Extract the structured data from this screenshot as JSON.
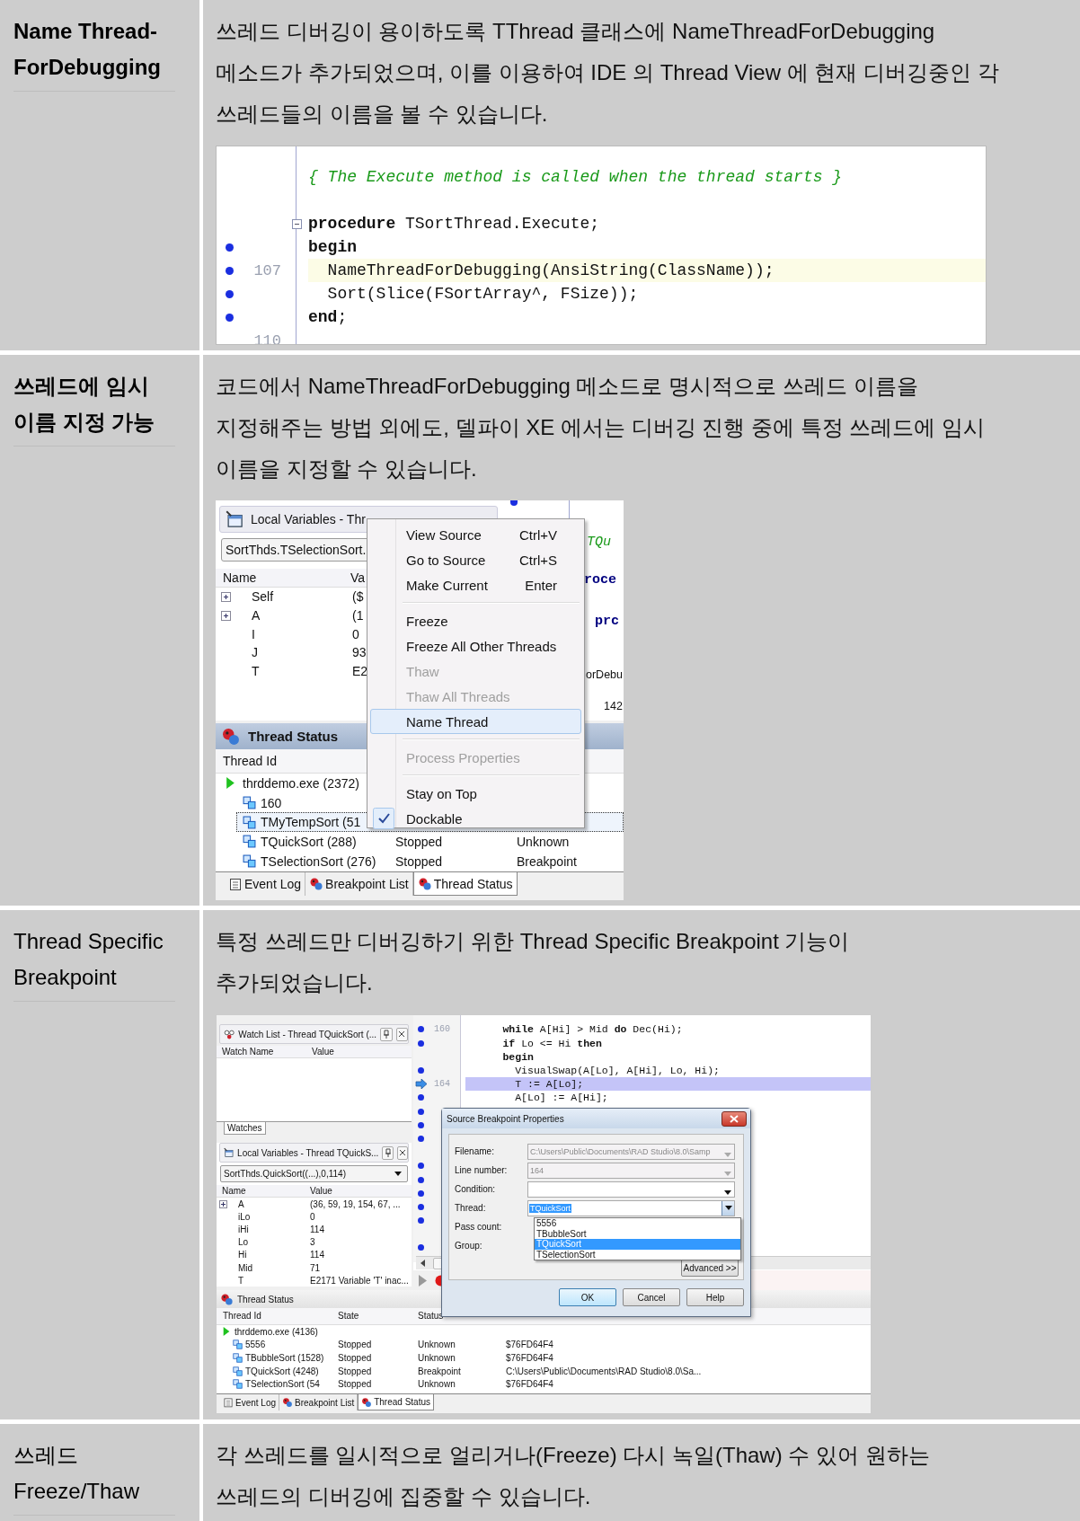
{
  "rows": [
    {
      "label": "Name Thread-ForDebugging",
      "label_bold": true,
      "text": "쓰레드 디버깅이 용이하도록 TThread 클래스에 NameThreadForDebugging 메소드가 추가되었으며, 이를 이용하여 IDE 의 Thread View 에 현재 디버깅중인 각 쓰레드들의 이름을 볼 수 있습니다.",
      "screenshot": {
        "kind": "code_editor",
        "lines": [
          {
            "kind": "blank",
            "breakpoint": false,
            "current": false,
            "fold": false
          },
          {
            "kind": "comment",
            "code": "{ The Execute method is called when the thread starts }",
            "breakpoint": false,
            "current": false,
            "fold": false
          },
          {
            "kind": "blank",
            "breakpoint": false,
            "current": false,
            "fold": false
          },
          {
            "kind": "code",
            "code": "**procedure** TSortThread.Execute;",
            "breakpoint": false,
            "current": false,
            "fold": true
          },
          {
            "kind": "code",
            "code": "**begin**",
            "breakpoint": true,
            "current": false,
            "fold": false
          },
          {
            "kind": "code",
            "code": "  NameThreadForDebugging(AnsiString(ClassName));",
            "number": "107",
            "breakpoint": true,
            "current": true,
            "fold": false
          },
          {
            "kind": "code",
            "code": "  Sort(Slice(FSortArray^, FSize));",
            "breakpoint": true,
            "current": false,
            "fold": false
          },
          {
            "kind": "code",
            "code": "**end**;",
            "breakpoint": true,
            "current": false,
            "fold": false
          },
          {
            "kind": "blank",
            "number": "110",
            "breakpoint": false,
            "current": false,
            "fold": false
          }
        ]
      }
    },
    {
      "label": "쓰레드에 임시 이름 지정 가능",
      "label_bold": true,
      "text": "코드에서 NameThreadForDebugging 메소드로 명시적으로 쓰레드 이름을 지정해주는 방법 외에도, 델파이 XE 에서는 디버깅 진행 중에 특정 쓰레드에 임시 이름을 지정할 수 있습니다.",
      "screenshot": {
        "kind": "thread_menu",
        "local_vars": {
          "title": "Local Variables - Thr",
          "scope": "SortThds.TSelectionSort.",
          "columns": [
            "Name",
            "Va"
          ],
          "vars": [
            {
              "name": "Self",
              "value": "($",
              "expandable": true
            },
            {
              "name": "A",
              "value": "(1",
              "expandable": true
            },
            {
              "name": "I",
              "value": "0",
              "expandable": false
            },
            {
              "name": "J",
              "value": "93",
              "expandable": false
            },
            {
              "name": "T",
              "value": "E2",
              "expandable": false
            }
          ]
        },
        "editor_fragments": [
          {
            "kind": "comment",
            "text": "TQu"
          },
          {
            "kind": "keyword",
            "text": "roce"
          },
          {
            "kind": "keyword",
            "text": "prc"
          },
          {
            "kind": "code",
            "text": "orDebu"
          },
          {
            "kind": "code",
            "text": "142"
          }
        ],
        "thread_status": {
          "title": "Thread Status",
          "columns": [
            "Thread Id"
          ],
          "threads": [
            {
              "name": "thrddemo.exe (2372)",
              "selected": false,
              "children": [
                {
                  "name": "160",
                  "selected": false
                },
                {
                  "name": "TMyTempSort (51",
                  "selected": true
                },
                {
                  "name": "TQuickSort (288)",
                  "state": "Stopped",
                  "status": "Unknown",
                  "selected": false
                },
                {
                  "name": "TSelectionSort (276)",
                  "state": "Stopped",
                  "status": "Breakpoint",
                  "selected": false
                }
              ]
            }
          ]
        },
        "tabs": [
          {
            "label": "Event Log",
            "selected": false
          },
          {
            "label": "Breakpoint List",
            "selected": false
          },
          {
            "label": "Thread Status",
            "selected": true
          }
        ],
        "menu": [
          {
            "kind": "item",
            "label": "View Source",
            "shortcut": "Ctrl+V",
            "disabled": false,
            "selected": false,
            "checked": false
          },
          {
            "kind": "item",
            "label": "Go to Source",
            "shortcut": "Ctrl+S",
            "disabled": false,
            "selected": false,
            "checked": false
          },
          {
            "kind": "item",
            "label": "Make Current",
            "shortcut": "Enter",
            "disabled": false,
            "selected": false,
            "checked": false
          },
          {
            "kind": "separator"
          },
          {
            "kind": "item",
            "label": "Freeze",
            "disabled": false,
            "selected": false,
            "checked": false
          },
          {
            "kind": "item",
            "label": "Freeze All Other Threads",
            "disabled": false,
            "selected": false,
            "checked": false
          },
          {
            "kind": "item",
            "label": "Thaw",
            "disabled": true,
            "selected": false,
            "checked": false
          },
          {
            "kind": "item",
            "label": "Thaw All Threads",
            "disabled": true,
            "selected": false,
            "checked": false
          },
          {
            "kind": "item",
            "label": "Name Thread",
            "disabled": false,
            "selected": true,
            "checked": false
          },
          {
            "kind": "separator"
          },
          {
            "kind": "item",
            "label": "Process Properties",
            "disabled": true,
            "selected": false,
            "checked": false
          },
          {
            "kind": "separator"
          },
          {
            "kind": "item",
            "label": "Stay on Top",
            "disabled": false,
            "selected": false,
            "checked": false
          },
          {
            "kind": "item",
            "label": "Dockable",
            "disabled": false,
            "selected": false,
            "checked": true
          }
        ]
      }
    },
    {
      "label": "Thread Specific Breakpoint",
      "label_bold": false,
      "text": "특정 쓰레드만 디버깅하기 위한 Thread Specific Breakpoint 기능이 추가되었습니다.",
      "screenshot": {
        "kind": "breakpoint_dialog",
        "watch_list": {
          "title": "Watch List - Thread TQuickSort (...",
          "columns": [
            "Watch Name",
            "Value"
          ],
          "tab": "Watches"
        },
        "local_vars": {
          "title": "Local Variables - Thread TQuickS...",
          "scope": "SortThds.QuickSort((...),0,114)",
          "columns": [
            "Name",
            "Value"
          ],
          "vars": [
            {
              "name": "A",
              "value": "(36, 59, 19, 154, 67, ...",
              "expandable": true
            },
            {
              "name": "iLo",
              "value": "0",
              "expandable": false
            },
            {
              "name": "iHi",
              "value": "114",
              "expandable": false
            },
            {
              "name": "Lo",
              "value": "3",
              "expandable": false
            },
            {
              "name": "Hi",
              "value": "114",
              "expandable": false
            },
            {
              "name": "Mid",
              "value": "71",
              "expandable": false
            },
            {
              "name": "T",
              "value": "E2171 Variable 'T' inac...",
              "expandable": false
            }
          ]
        },
        "lines": [
          {
            "kind": "code",
            "code": "      **while** A[Hi] > Mid **do** Dec(Hi);",
            "number": "160",
            "breakpoint": true,
            "current": false
          },
          {
            "kind": "code",
            "code": "      **if** Lo <= Hi **then**",
            "breakpoint": true,
            "current": false
          },
          {
            "kind": "code",
            "code": "      **begin**",
            "breakpoint": false,
            "current": false
          },
          {
            "kind": "code",
            "code": "        VisualSwap(A[Lo], A[Hi], Lo, Hi);",
            "breakpoint": true,
            "current": false
          },
          {
            "kind": "code",
            "code": "        T := A[Lo];",
            "number": "164",
            "breakpoint": false,
            "current": true
          },
          {
            "kind": "code",
            "code": "        A[Lo] := A[Hi];",
            "breakpoint": true,
            "current": false
          },
          {
            "kind": "blank",
            "breakpoint": true,
            "current": false
          },
          {
            "kind": "blank",
            "breakpoint": true,
            "current": false
          },
          {
            "kind": "blank",
            "breakpoint": true,
            "current": false
          },
          {
            "kind": "blank",
            "breakpoint": false,
            "current": false
          },
          {
            "kind": "blank",
            "breakpoint": true,
            "current": false
          },
          {
            "kind": "blank",
            "breakpoint": true,
            "current": false
          },
          {
            "kind": "blank",
            "breakpoint": true,
            "current": false
          },
          {
            "kind": "blank",
            "breakpoint": true,
            "current": false
          },
          {
            "kind": "blank",
            "breakpoint": true,
            "current": false
          },
          {
            "kind": "blank",
            "breakpoint": false,
            "current": false
          },
          {
            "kind": "blank",
            "breakpoint": true,
            "current": false
          }
        ],
        "thread_status": {
          "title": "Thread Status",
          "columns": [
            "Thread Id",
            "State",
            "Status"
          ],
          "threads": [
            {
              "name": "thrddemo.exe (4136)",
              "selected": false,
              "children": [
                {
                  "name": "5556",
                  "state": "Stopped",
                  "status": "Unknown",
                  "location": "$76FD64F4",
                  "selected": false
                },
                {
                  "name": "TBubbleSort (1528)",
                  "state": "Stopped",
                  "status": "Unknown",
                  "location": "$76FD64F4",
                  "selected": false
                },
                {
                  "name": "TQuickSort (4248)",
                  "state": "Stopped",
                  "status": "Breakpoint",
                  "location": "C:\\Users\\Public\\Documents\\RAD Studio\\8.0\\Sa...",
                  "selected": false
                },
                {
                  "name": "TSelectionSort (54",
                  "state": "Stopped",
                  "status": "Unknown",
                  "location": "$76FD64F4",
                  "selected": false
                }
              ]
            }
          ]
        },
        "tabs": [
          {
            "label": "Event Log",
            "selected": false
          },
          {
            "label": "Breakpoint List",
            "selected": false
          },
          {
            "label": "Thread Status",
            "selected": true
          }
        ],
        "dialog": {
          "title": "Source Breakpoint Properties",
          "fields": [
            {
              "label": "Filename:",
              "value": "C:\\Users\\Public\\Documents\\RAD Studio\\8.0\\Samp",
              "disabled": true
            },
            {
              "label": "Line number:",
              "value": "164",
              "disabled": true
            },
            {
              "label": "Condition:",
              "disabled": false
            },
            {
              "label": "Thread:",
              "value": "TQuickSort",
              "disabled": false
            }
          ],
          "labels": [
            "Pass count:",
            "Group:"
          ],
          "thread_options": [
            {
              "label": "5556",
              "selected": false
            },
            {
              "label": "TBubbleSort",
              "selected": false
            },
            {
              "label": "TQuickSort",
              "selected": true
            },
            {
              "label": "TSelectionSort",
              "selected": false
            }
          ],
          "advanced": "Advanced >>",
          "buttons": [
            "OK",
            "Cancel",
            "Help"
          ]
        }
      }
    },
    {
      "label": "쓰레드 Freeze/Thaw",
      "label_bold": false,
      "text": "각 쓰레드를 일시적으로 얼리거나(Freeze) 다시 녹일(Thaw) 수 있어 원하는 쓰레드의 디버깅에 집중할 수 있습니다."
    }
  ]
}
